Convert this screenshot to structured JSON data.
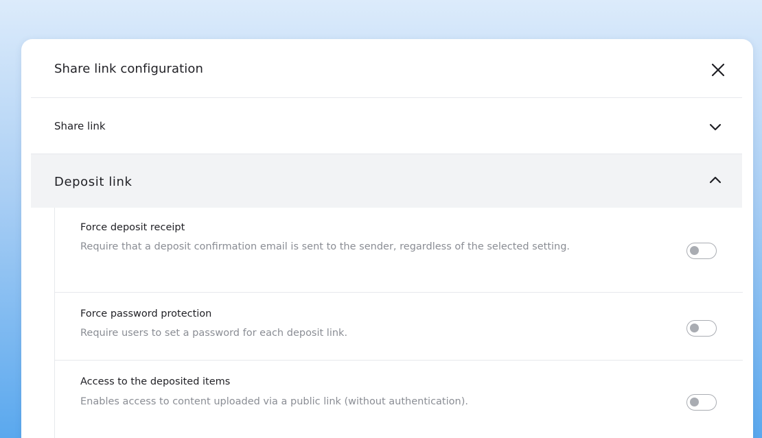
{
  "modal": {
    "title": "Share link configuration"
  },
  "sections": {
    "share_link": {
      "label": "Share link",
      "expanded": false
    },
    "deposit_link": {
      "label": "Deposit link",
      "expanded": true
    }
  },
  "deposit_settings": [
    {
      "title": "Force deposit receipt",
      "description": "Require that a deposit confirmation email is sent to the sender, regardless of the selected setting.",
      "enabled": false
    },
    {
      "title": "Force password protection",
      "description": "Require users to set a password for each deposit link.",
      "enabled": false
    },
    {
      "title": "Access to the deposited items",
      "description": "Enables access to content uploaded via a public link (without authentication).",
      "enabled": false
    }
  ],
  "icons": {
    "close": "close-icon",
    "collapsed": "chevron-down-icon",
    "expanded": "chevron-up-icon"
  },
  "colors": {
    "background_top": "#dcebfb",
    "background_bottom": "#5aa8ee",
    "text_primary": "#1f1f24",
    "text_secondary": "#8a8d94",
    "section_active_bg": "#f2f3f5",
    "toggle_off": "#a9acb2"
  }
}
